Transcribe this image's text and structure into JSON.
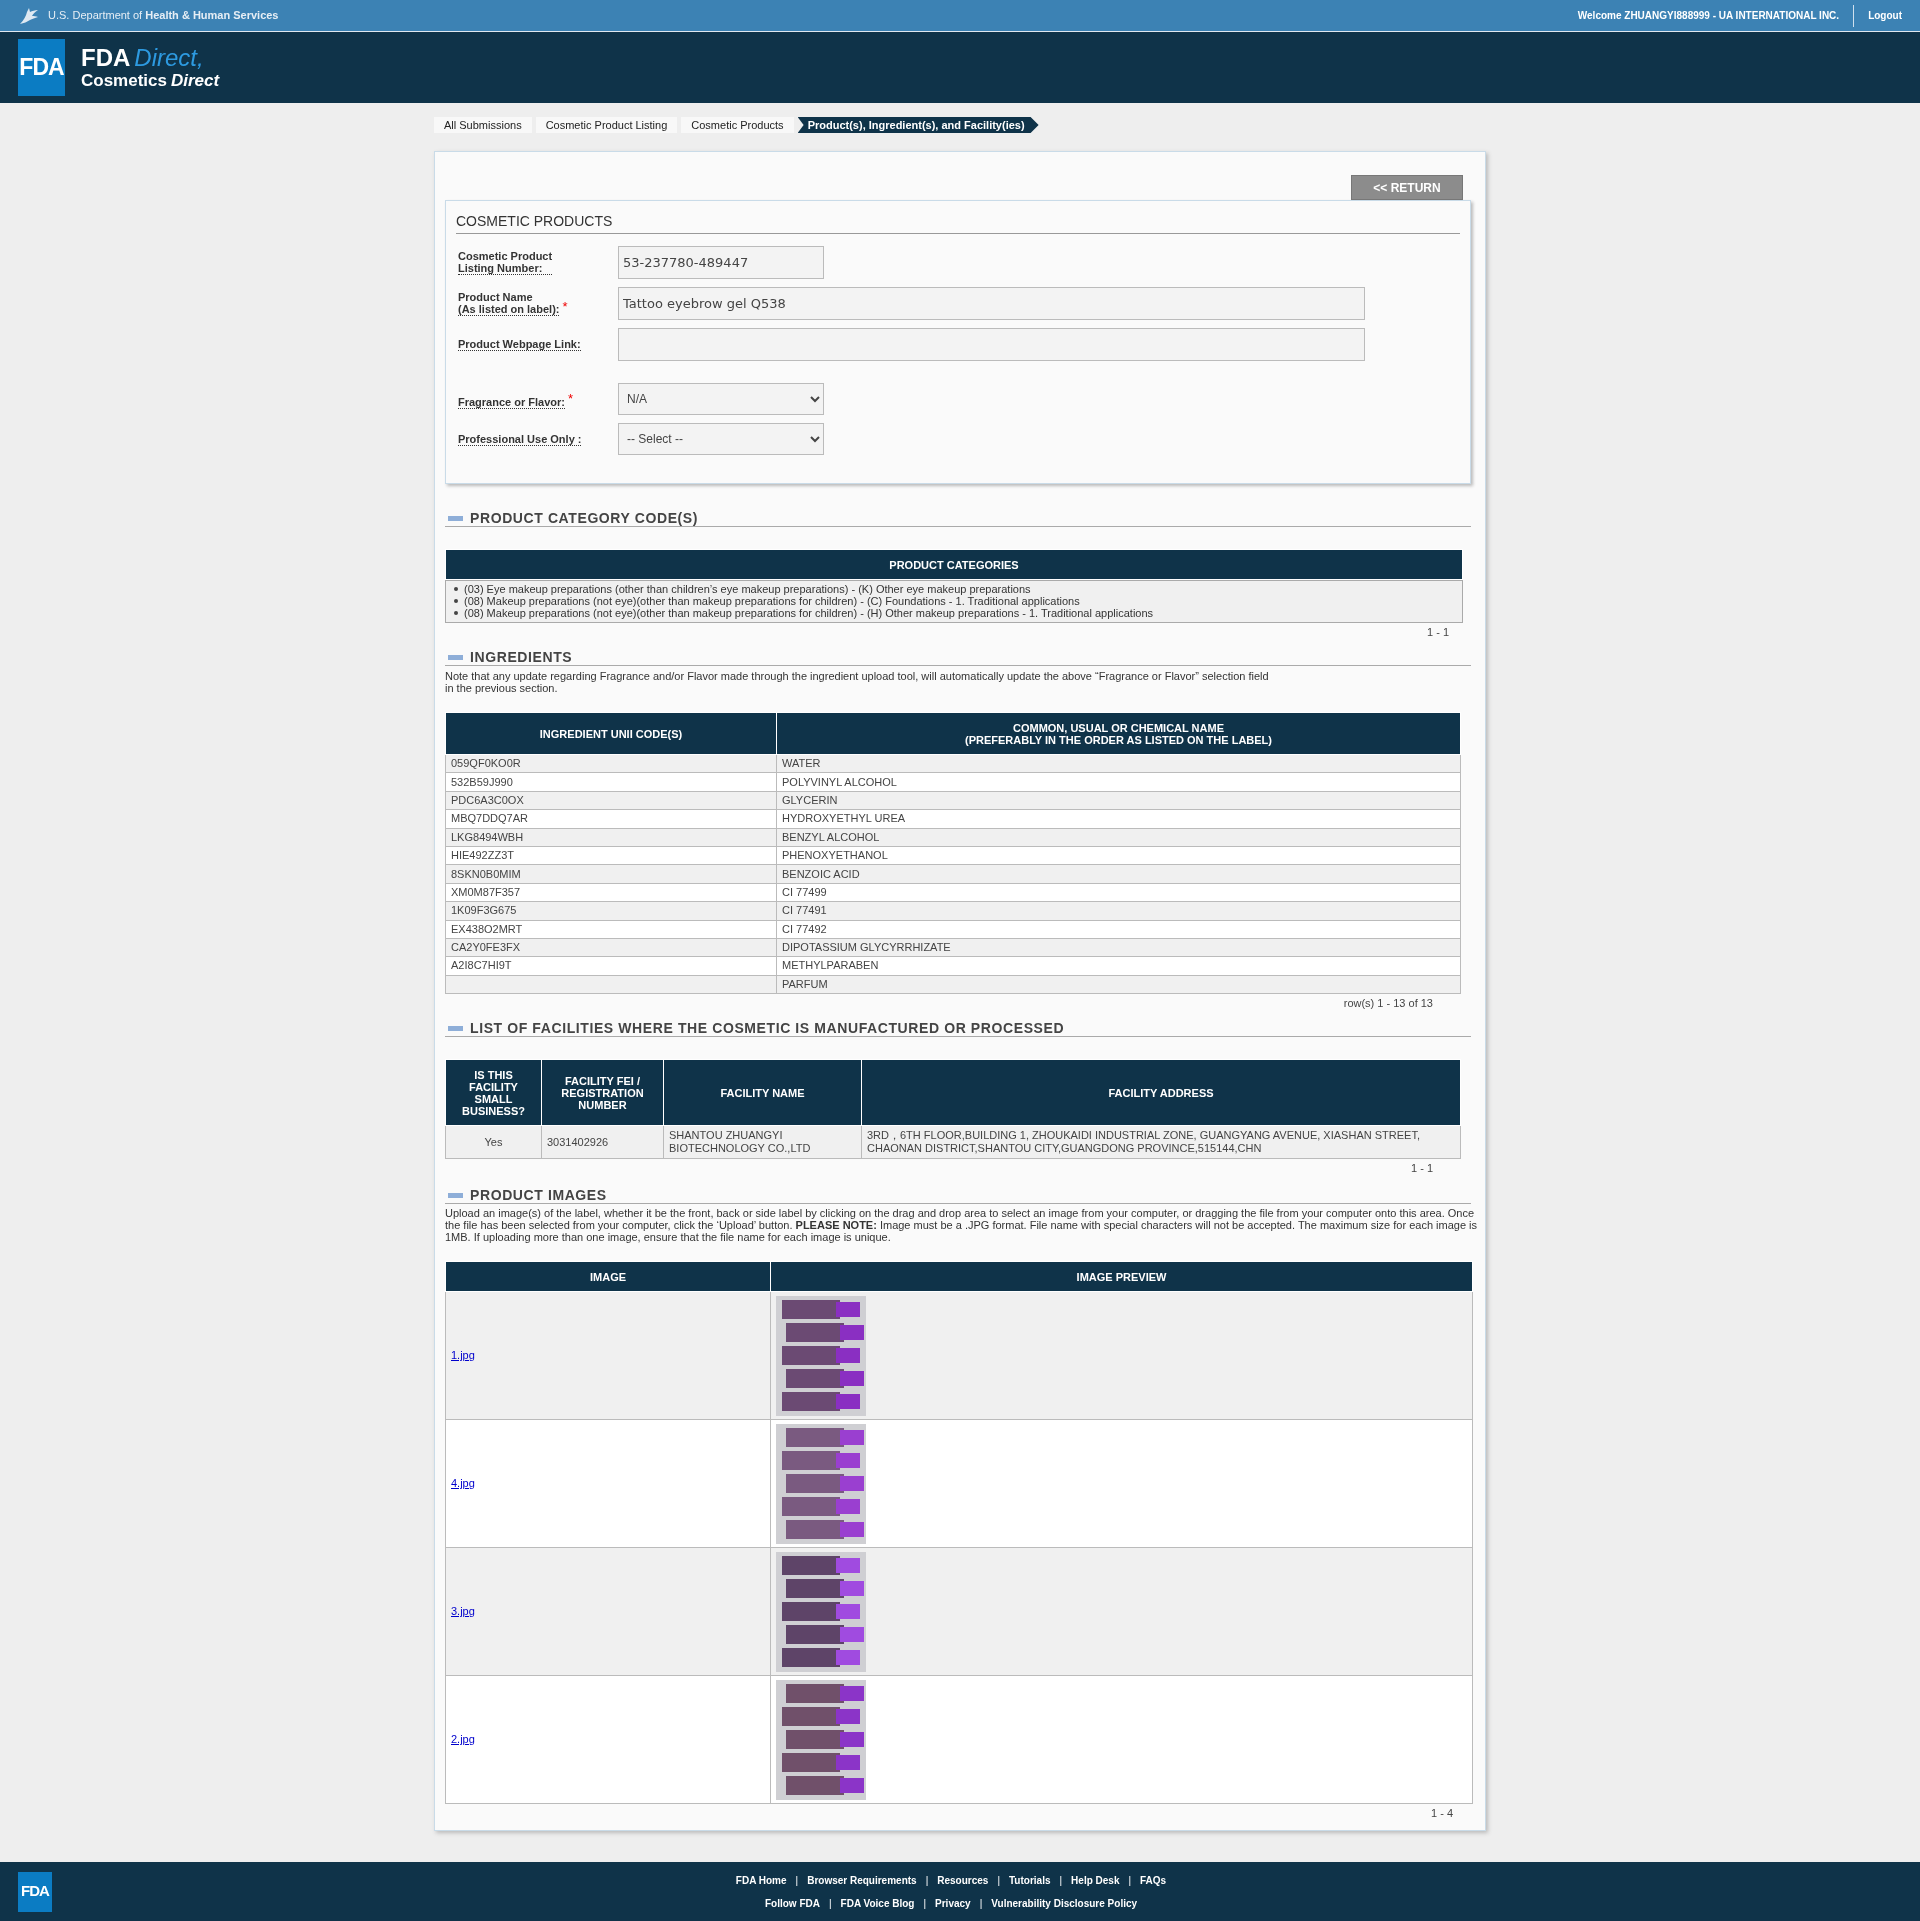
{
  "top_bar": {
    "department": "U.S. Department of **Health & Human Services**",
    "welcome": "Welcome ZHUANGYI888999 - UA INTERNATIONAL INC.",
    "logout": "Logout"
  },
  "header": {
    "logo_box": "FDA",
    "title": "FDA",
    "title_accent": "Direct,",
    "subtitle": "Cosmetics",
    "subtitle_accent": "Direct"
  },
  "breadcrumb": [
    {
      "label": "All Submissions",
      "selected": false
    },
    {
      "label": "Cosmetic Product Listing",
      "selected": false
    },
    {
      "label": "Cosmetic Products",
      "selected": false
    },
    {
      "label": "Product(s), Ingredient(s), and Facility(ies)",
      "selected": true
    }
  ],
  "return_button": "<< RETURN",
  "cosmetic_products": {
    "title": "COSMETIC PRODUCTS",
    "required_mark": "*",
    "fields": [
      {
        "kind": "text",
        "label": "Cosmetic Product\nListing Number:",
        "value": "53-237780-489447",
        "required": false
      },
      {
        "kind": "text",
        "label": "Product Name\n(As listed on label):",
        "value": "Tattoo eyebrow gel Q538",
        "required": true
      },
      {
        "kind": "text",
        "label": "Product Webpage Link:",
        "required": false
      },
      {
        "kind": "select",
        "label": "Fragrance or Flavor:",
        "value": "N/A",
        "required": true
      },
      {
        "kind": "select",
        "label": "Professional Use Only :",
        "value": "-- Select --",
        "required": false
      }
    ]
  },
  "category_section": {
    "title": "PRODUCT CATEGORY CODE(S)",
    "table_header": "PRODUCT CATEGORIES",
    "items": [
      "(03) Eye makeup preparations (other than children’s eye makeup preparations) - (K) Other eye makeup preparations",
      "(08) Makeup preparations (not eye)(other than makeup preparations for children) - (C) Foundations - 1. Traditional applications",
      "(08) Makeup preparations (not eye)(other than makeup preparations for children) - (H) Other makeup preparations - 1. Traditional applications"
    ],
    "pager": "1 - 1"
  },
  "ingredients_section": {
    "title": "INGREDIENTS",
    "note": "Note that any update regarding Fragrance and/or Flavor made through the ingredient upload tool, will automatically update the above “Fragrance or Flavor” selection field\nin the previous section.",
    "columns": [
      "INGREDIENT UNII CODE(S)",
      "COMMON, USUAL OR CHEMICAL NAME\n(PREFERABLY IN THE ORDER AS LISTED ON THE LABEL)"
    ],
    "rows": [
      [
        "059QF0KO0R",
        "WATER"
      ],
      [
        "532B59J990",
        "POLYVINYL ALCOHOL"
      ],
      [
        "PDC6A3C0OX",
        "GLYCERIN"
      ],
      [
        "MBQ7DDQ7AR",
        "HYDROXYETHYL UREA"
      ],
      [
        "LKG8494WBH",
        "BENZYL ALCOHOL"
      ],
      [
        "HIE492ZZ3T",
        "PHENOXYETHANOL"
      ],
      [
        "8SKN0B0MIM",
        "BENZOIC ACID"
      ],
      [
        "XM0M87F357",
        "CI 77499"
      ],
      [
        "1K09F3G675",
        "CI 77491"
      ],
      [
        "EX438O2MRT",
        "CI 77492"
      ],
      [
        "CA2Y0FE3FX",
        "DIPOTASSIUM GLYCYRRHIZATE"
      ],
      [
        "A2I8C7HI9T",
        "METHYLPARABEN"
      ],
      [
        "",
        "PARFUM"
      ]
    ],
    "pager": "row(s) 1 - 13 of 13"
  },
  "facilities_section": {
    "title": "LIST OF FACILITIES WHERE THE COSMETIC IS MANUFACTURED OR PROCESSED",
    "columns": [
      "IS THIS FACILITY SMALL BUSINESS?",
      "FACILITY FEI / REGISTRATION NUMBER",
      "FACILITY NAME",
      "FACILITY ADDRESS"
    ],
    "rows": [
      [
        "Yes",
        "3031402926",
        "SHANTOU ZHUANGYI BIOTECHNOLOGY CO.,LTD",
        "3RD，6TH FLOOR,BUILDING 1, ZHOUKAIDI INDUSTRIAL ZONE, GUANGYANG AVENUE, XIASHAN STREET, CHAONAN DISTRICT,SHANTOU CITY,GUANGDONG PROVINCE,515144,CHN"
      ]
    ],
    "pager": "1 - 1"
  },
  "images_section": {
    "title": "PRODUCT IMAGES",
    "note": "Upload an image(s) of the label, whether it be the front, back or side label by clicking on the drag and drop area to select an image from your computer, or dragging the file from your computer onto this area. Once the file has been selected from your computer, click the ‘Upload’ button. **PLEASE NOTE:** Image must be a .JPG format. File name with special characters will not be accepted. The maximum size for each image is 1MB. If uploading more than one image, ensure that the file name for each image is unique.",
    "columns": [
      "IMAGE",
      "IMAGE PREVIEW"
    ],
    "rows": [
      {
        "file": "1.jpg",
        "kind": "picture"
      },
      {
        "file": "4.jpg",
        "kind": "picture"
      },
      {
        "file": "3.jpg",
        "kind": "picture"
      },
      {
        "file": "2.jpg",
        "kind": "picture"
      }
    ],
    "pager": "1 - 4"
  },
  "footer": {
    "logo": "FDA",
    "separator": "|",
    "rows": [
      [
        "FDA Home",
        "Browser Requirements",
        "Resources",
        "Tutorials",
        "Help Desk",
        "FAQs"
      ],
      [
        "Follow FDA",
        "FDA Voice Blog",
        "Privacy",
        "Vulnerability Disclosure Policy"
      ]
    ]
  }
}
